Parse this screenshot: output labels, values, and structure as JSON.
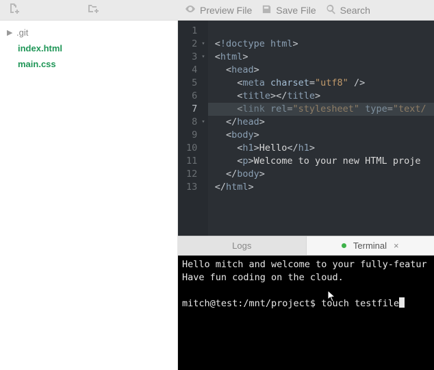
{
  "toolbar": {
    "preview_label": "Preview File",
    "save_label": "Save File",
    "search_label": "Search"
  },
  "sidebar": {
    "items": [
      {
        "label": ".git",
        "kind": "folder"
      },
      {
        "label": "index.html",
        "kind": "file"
      },
      {
        "label": "main.css",
        "kind": "file"
      }
    ]
  },
  "editor": {
    "lines": [
      "<!doctype html>",
      "<html>",
      "  <head>",
      "    <meta charset=\"utf8\" />",
      "    <title></title>",
      "    <link rel=\"stylesheet\" type=\"text/",
      "  </head>",
      "  <body>",
      "    <h1>Hello</h1>",
      "    <p>Welcome to your new HTML proje",
      "  </body>",
      "</html>",
      ""
    ],
    "line_count": 13,
    "active_line": 7,
    "foldable_lines": [
      2,
      3,
      8
    ]
  },
  "panel": {
    "tabs": [
      {
        "label": "Logs",
        "active": false
      },
      {
        "label": "Terminal",
        "active": true,
        "indicator": "green",
        "closable": true
      }
    ]
  },
  "terminal": {
    "motd_l1": "Hello mitch and welcome to your fully-featur",
    "motd_l2": "Have fun coding on the cloud.",
    "prompt": "mitch@test:/mnt/project$ ",
    "command": "touch testfile"
  },
  "colors": {
    "file_green": "#1f9657",
    "editor_bg": "#2b2f34",
    "editor_gutter": "#272b30",
    "terminal_green_dot": "#3eb24a",
    "syntax_tag": "#8ba0b4",
    "syntax_attr": "#a3bcd2",
    "syntax_value": "#c19a6b"
  },
  "icons": {
    "new_file": "new-file-icon",
    "new_folder": "new-folder-icon",
    "eye": "eye-icon",
    "save": "save-icon",
    "search": "search-icon",
    "chevron_right": "chevron-right-icon",
    "fold_collapsed": "fold-icon"
  }
}
